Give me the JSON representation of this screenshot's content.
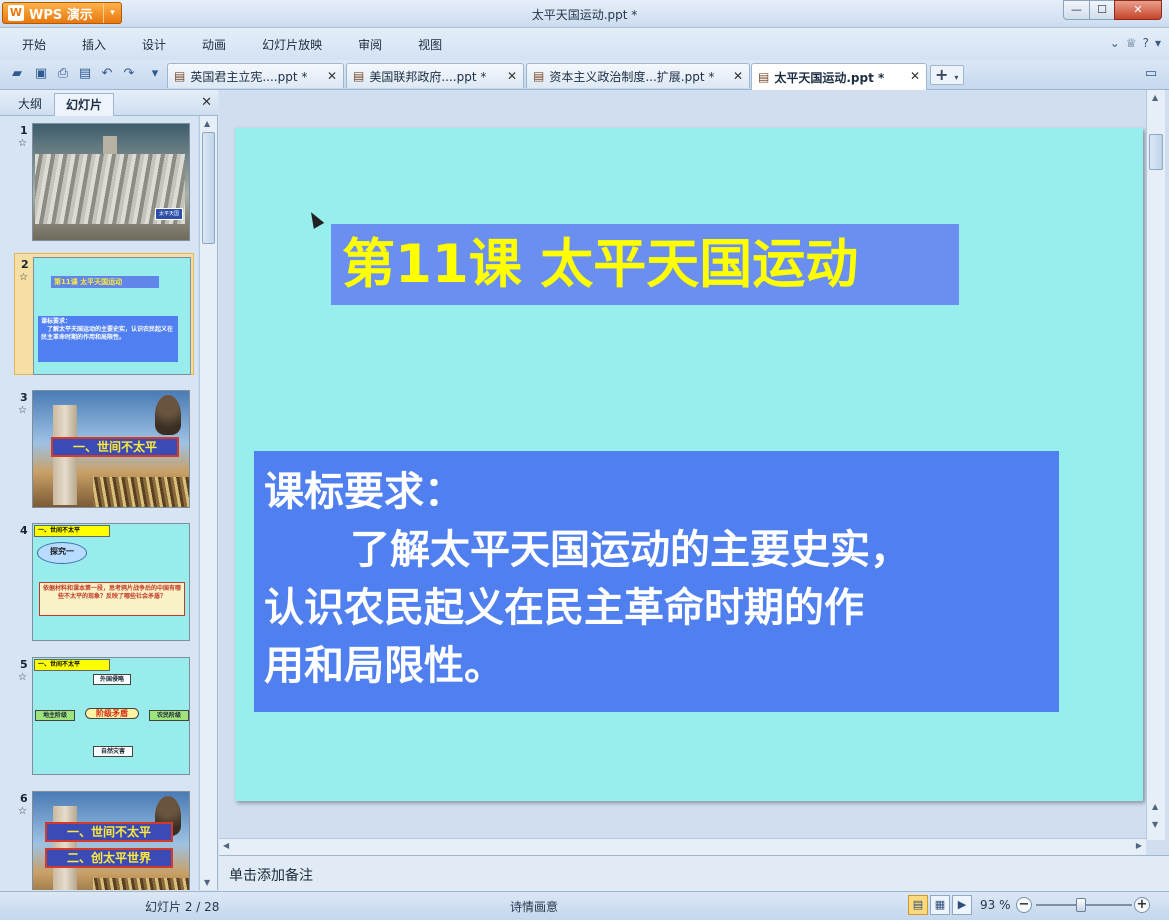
{
  "app": {
    "menu_button_label": "WPS 演示",
    "window_title": "太平天国运动.ppt *",
    "min_label": "—",
    "max_label": "☐",
    "close_label": "✕"
  },
  "menu": {
    "items": [
      "开始",
      "插入",
      "设计",
      "动画",
      "幻灯片放映",
      "审阅",
      "视图"
    ]
  },
  "doc_tabs": [
    {
      "label": "英国君主立宪....ppt *"
    },
    {
      "label": "美国联邦政府....ppt *"
    },
    {
      "label": "资本主义政治制度...扩展.ppt *"
    },
    {
      "label": "太平天国运动.ppt *"
    }
  ],
  "left_panel": {
    "tab_outline": "大纲",
    "tab_slides": "幻灯片",
    "slides": [
      {
        "num": "1",
        "caption": "太平天国"
      },
      {
        "num": "2",
        "title": "第11课  太平天国运动",
        "body": "课标要求：\n　了解太平天国运动的主要史实，认识农民起义在民主革命时期的作用和局限性。"
      },
      {
        "num": "3",
        "banner": "一、世间不太平"
      },
      {
        "num": "4",
        "header": "一、世间不太平",
        "cloud": "探究一",
        "question": "依据材料和课本第一段，思考鸦片战争后的中国有哪些不太平的现象？反映了哪些社会矛盾？"
      },
      {
        "num": "5",
        "header": "一、世间不太平",
        "top": "外国侵略",
        "left": "地主阶级",
        "center": "阶级矛盾",
        "right": "农民阶级",
        "bottom": "自然灾害"
      },
      {
        "num": "6",
        "banner1": "一、世间不太平",
        "banner2": "二、创太平世界"
      }
    ]
  },
  "current_slide": {
    "title": "第11课  太平天国运动",
    "body_line1": "课标要求：",
    "body_line2": "了解太平天国运动的主要史实，",
    "body_line3": "认识农民起义在民主革命时期的作",
    "body_line4": "用和局限性。"
  },
  "notes_placeholder": "单击添加备注",
  "status": {
    "slide_counter": "幻灯片 2 / 28",
    "theme": "诗情画意",
    "zoom": "93 %",
    "zoom_fraction": 0.47
  }
}
